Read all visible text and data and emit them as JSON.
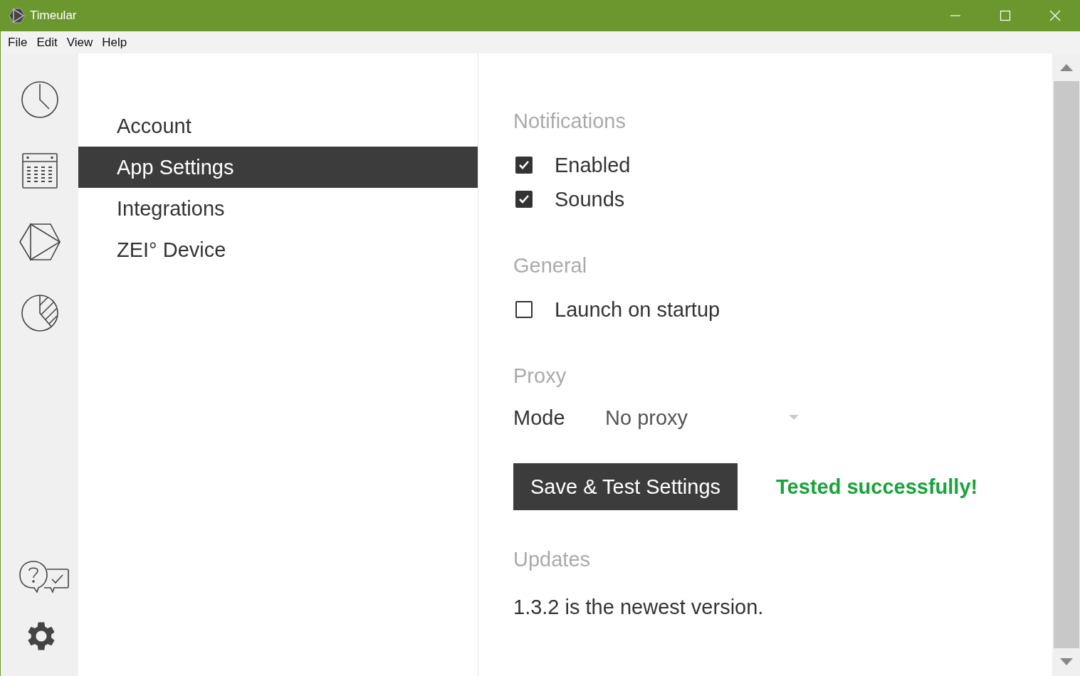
{
  "window": {
    "title": "Timeular"
  },
  "menu": [
    "File",
    "Edit",
    "View",
    "Help"
  ],
  "nav": [
    {
      "label": "Account",
      "selected": false
    },
    {
      "label": "App Settings",
      "selected": true
    },
    {
      "label": "Integrations",
      "selected": false
    },
    {
      "label": "ZEI° Device",
      "selected": false
    }
  ],
  "sections": [
    {
      "heading": "Notifications",
      "items": [
        {
          "kind": "checkbox",
          "label": "Enabled",
          "checked": true
        },
        {
          "kind": "checkbox",
          "label": "Sounds",
          "checked": true
        }
      ]
    },
    {
      "heading": "General",
      "items": [
        {
          "kind": "checkbox",
          "label": "Launch on startup",
          "checked": false
        }
      ]
    },
    {
      "heading": "Proxy",
      "items": [
        {
          "kind": "select",
          "label": "Mode",
          "value": "No proxy"
        },
        {
          "kind": "action",
          "button": "Save & Test Settings",
          "status": "Tested successfully!"
        }
      ]
    },
    {
      "heading": "Updates",
      "items": [
        {
          "kind": "text",
          "text": "1.3.2 is the newest version."
        }
      ]
    }
  ]
}
